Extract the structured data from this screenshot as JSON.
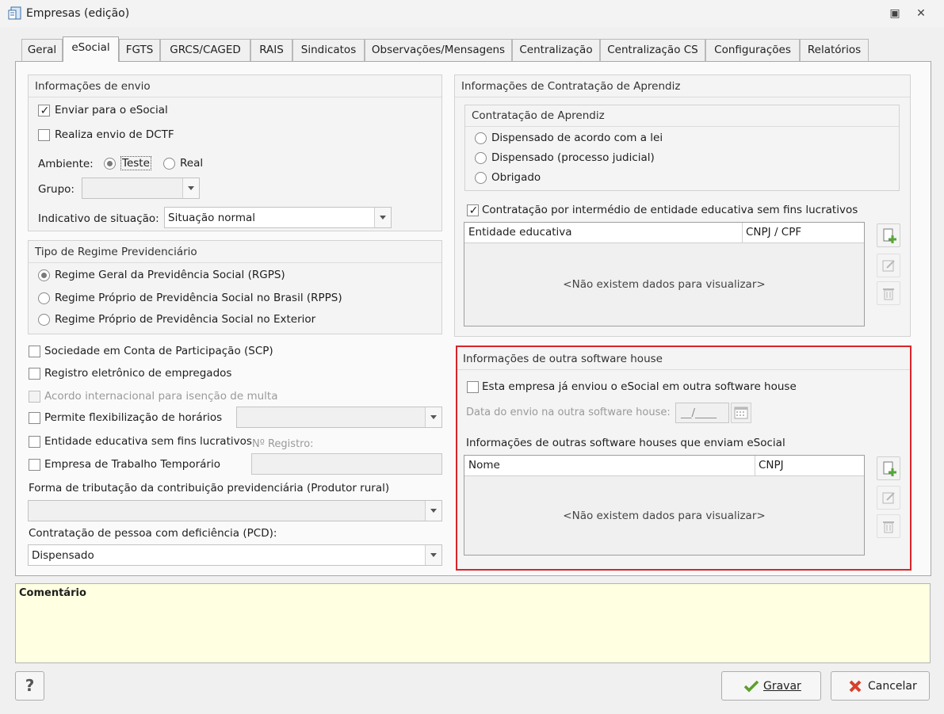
{
  "window": {
    "title": "Empresas (edição)",
    "restore_glyph": "▣",
    "close_glyph": "✕"
  },
  "tabs": [
    {
      "label": "Geral"
    },
    {
      "label": "eSocial"
    },
    {
      "label": "FGTS"
    },
    {
      "label": "GRCS/CAGED"
    },
    {
      "label": "RAIS"
    },
    {
      "label": "Sindicatos"
    },
    {
      "label": "Observações/Mensagens"
    },
    {
      "label": "Centralização"
    },
    {
      "label": "Centralização CS"
    },
    {
      "label": "Configurações"
    },
    {
      "label": "Relatórios"
    }
  ],
  "envio": {
    "title": "Informações de envio",
    "enviar_label": "Enviar para o eSocial",
    "enviar_checked": true,
    "dctf_label": "Realiza envio de DCTF",
    "dctf_checked": false,
    "ambiente_label": "Ambiente:",
    "teste_label": "Teste",
    "real_label": "Real",
    "ambiente_selected": "Teste",
    "grupo_label": "Grupo:",
    "grupo_value": "",
    "situacao_label": "Indicativo de situação:",
    "situacao_value": "Situação normal"
  },
  "regime": {
    "title": "Tipo de Regime Previdenciário",
    "options": [
      "Regime Geral da Previdência Social (RGPS)",
      "Regime Próprio de Previdência Social no Brasil (RPPS)",
      "Regime Próprio de Previdência Social no Exterior"
    ],
    "selected": "Regime Geral da Previdência Social (RGPS)"
  },
  "opcoes": {
    "scp_label": "Sociedade em Conta de Participação (SCP)",
    "registro_label": "Registro eletrônico de empregados",
    "acordo_label": "Acordo internacional para isenção de multa",
    "flex_label": "Permite flexibilização de horários",
    "entidade_label": "Entidade educativa sem fins lucrativos",
    "n_registro_label": "Nº Registro:",
    "temporario_label": "Empresa de Trabalho Temporário",
    "forma_label": "Forma de tributação da contribuição previdenciária (Produtor rural)",
    "forma_value": "",
    "pcd_label": "Contratação de pessoa com deficiência (PCD):",
    "pcd_value": "Dispensado"
  },
  "aprendiz": {
    "title": "Informações de Contratação de Aprendiz",
    "sub_title": "Contratação de Aprendiz",
    "options": [
      "Dispensado de acordo com a lei",
      "Dispensado (processo judicial)",
      "Obrigado"
    ],
    "intermedio_label": "Contratação por intermédio de entidade educativa sem fins lucrativos",
    "intermedio_checked": true,
    "col1": "Entidade educativa",
    "col2": "CNPJ / CPF",
    "empty": "<Não existem dados para visualizar>"
  },
  "software_house": {
    "title": "Informações de outra software house",
    "enviou_label": "Esta empresa já enviou o eSocial em outra software house",
    "data_label": "Data do envio na outra software house:",
    "data_value": "__/____",
    "lista_title": "Informações de outras software houses que enviam eSocial",
    "col1": "Nome",
    "col2": "CNPJ",
    "empty": "<Não existem dados para visualizar>"
  },
  "comment": {
    "title": "Comentário"
  },
  "footer": {
    "help": "?",
    "gravar": "Gravar",
    "cancelar": "Cancelar"
  },
  "colors": {
    "highlight_border": "#d9252a",
    "comment_bg": "#ffffe1"
  }
}
